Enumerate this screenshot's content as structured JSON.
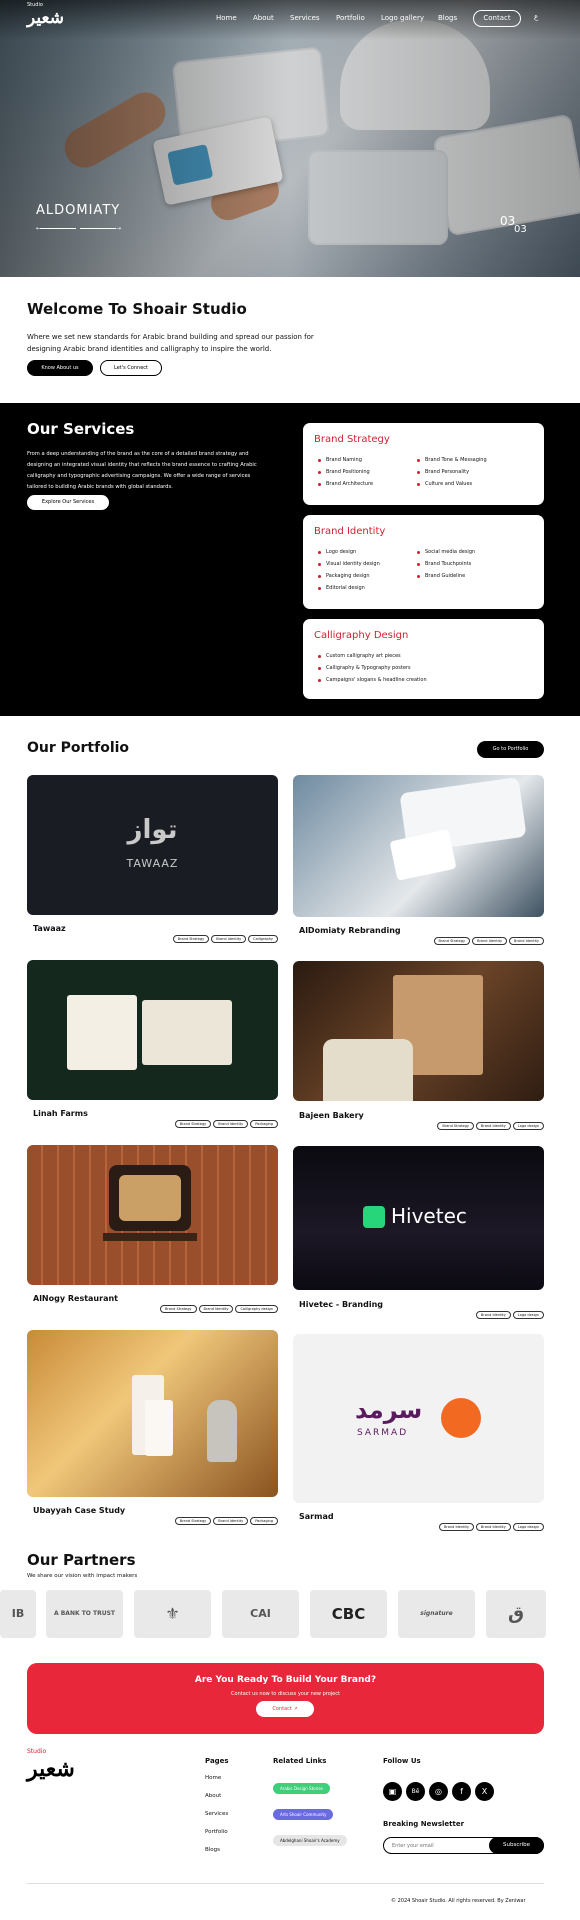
{
  "nav": {
    "logo_small": "Studio",
    "logo": "شعير",
    "items": [
      "Home",
      "About",
      "Services",
      "Portfolio",
      "Logo gallery",
      "Blogs"
    ],
    "contact": "Contact",
    "lang": "ع"
  },
  "hero": {
    "slide_title": "ALDOMIATY",
    "prev_arrow": "←",
    "next_arrow": "→",
    "counter_current": "03",
    "counter_total": "03"
  },
  "welcome": {
    "title": "Welcome To Shoair Studio",
    "text": "Where we set new standards for Arabic brand building and spread our passion for designing Arabic brand identities and calligraphy to inspire the world.",
    "btn_about": "Know About us",
    "btn_connect": "Let's Connect"
  },
  "services": {
    "title": "Our Services",
    "text": "From a deep understanding of the brand as the core of a detailed brand strategy and designing an integrated visual identity that reflects the brand essence to crafting Arabic calligraphy and typographic advertising campaigns. We offer a wide range of services tailored to building Arabic brands with global standards.",
    "explore": "Explore Our Services",
    "cards": [
      {
        "title": "Brand Strategy",
        "left": [
          "Brand Naming",
          "Brand Positioning",
          "Brand Architecture"
        ],
        "right": [
          "Brand Tone & Messaging",
          "Brand Personality",
          "Culture and Values"
        ]
      },
      {
        "title": "Brand Identity",
        "left": [
          "Logo design",
          "Visual identity design",
          "Packaging design",
          "Editorial design"
        ],
        "right": [
          "Social media design",
          "Brand Touchpoints",
          "Brand Guideline"
        ]
      },
      {
        "title": "Calligraphy Design",
        "left": [
          "Custom calligraphy art pieces",
          "Calligraphy & Typography posters",
          "Campaigns' slogans & headline creation"
        ],
        "right": []
      }
    ]
  },
  "portfolio": {
    "title": "Our Portfolio",
    "go": "Go to Portfolio",
    "items": [
      {
        "name": "Tawaaz",
        "tags": [
          "Brand Strategy",
          "Brand Identity",
          "Calligraphy"
        ],
        "logo_ar": "تواز",
        "logo_en": "TAWAAZ"
      },
      {
        "name": "AlDomiaty Rebranding",
        "tags": [
          "Brand Strategy",
          "Brand Identity",
          "Brand Identity"
        ]
      },
      {
        "name": "Linah Farms",
        "tags": [
          "Brand Strategy",
          "Brand Identity",
          "Packaging"
        ]
      },
      {
        "name": "Bajeen Bakery",
        "tags": [
          "Brand Strategy",
          "Brand Identity",
          "Logo design"
        ]
      },
      {
        "name": "AlNogy Restaurant",
        "tags": [
          "Brand Strategy",
          "Brand Identity",
          "Calligraphy design"
        ]
      },
      {
        "name": "Hivetec - Branding",
        "tags": [
          "Brand Identity",
          "Logo design"
        ],
        "logo": "Hivetec"
      },
      {
        "name": "Ubayyah Case Study",
        "tags": [
          "Brand Strategy",
          "Brand Identity",
          "Packaging"
        ]
      },
      {
        "name": "Sarmad",
        "tags": [
          "Brand Identity",
          "Brand Identity",
          "Logo design"
        ],
        "logo_ar": "سرمد",
        "logo_en": "SARMAD"
      }
    ]
  },
  "partners": {
    "title": "Our Partners",
    "subtitle": "We share our vision with impact makers",
    "logos": [
      "IB",
      "A BANK TO TRUST",
      "⚜",
      "CAI",
      "CBC",
      "signature",
      "ق"
    ]
  },
  "cta": {
    "title": "Are You Ready To Build Your Brand?",
    "text": "Contact us now to discuss your new project",
    "button": "Contact ↗"
  },
  "footer": {
    "logo_small": "Studio",
    "logo": "شعير",
    "pages_title": "Pages",
    "pages": [
      "Home",
      "About",
      "Services",
      "Portfolio",
      "Blogs"
    ],
    "related_title": "Related Links",
    "related": [
      "Arabic Design Stories",
      "Arts Shoair Community",
      "Abdelghani Shoair's Academy"
    ],
    "follow_title": "Follow Us",
    "social": [
      "▣",
      "Bē",
      "◎",
      "f",
      "X"
    ],
    "newsletter_title": "Breaking Newsletter",
    "email_placeholder": "Enter your email",
    "subscribe": "Subscribe",
    "copyright": "© 2024 Shoair Studio. All rights reserved. By Zeniwar"
  },
  "colors": {
    "accent": "#e8273a",
    "brand_red": "#d11f2f",
    "black": "#000000"
  }
}
